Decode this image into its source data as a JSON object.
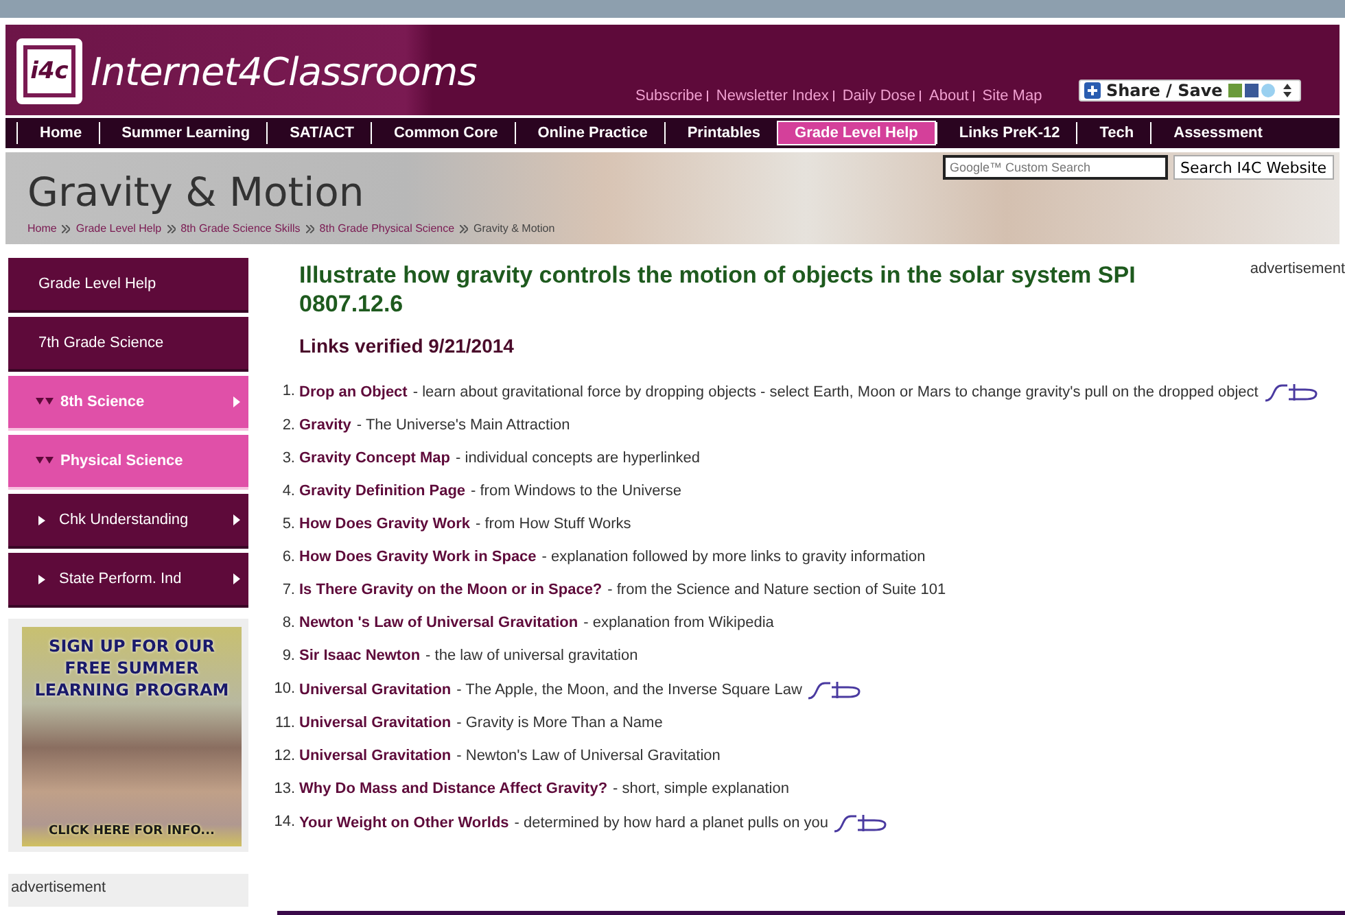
{
  "header": {
    "logo_mark": "i4c",
    "site_name": "Internet4Classrooms",
    "links": [
      "Subscribe",
      "Newsletter Index",
      "Daily Dose",
      "About",
      "Site Map"
    ],
    "share_button": "Share / Save"
  },
  "nav": [
    {
      "label": "Home",
      "selected": false
    },
    {
      "label": "Summer Learning",
      "selected": false
    },
    {
      "label": "SAT/ACT",
      "selected": false
    },
    {
      "label": "Common Core",
      "selected": false
    },
    {
      "label": "Online Practice",
      "selected": false
    },
    {
      "label": "Printables",
      "selected": false
    },
    {
      "label": "Grade Level Help",
      "selected": true
    },
    {
      "label": "Links PreK-12",
      "selected": false
    },
    {
      "label": "Tech",
      "selected": false
    },
    {
      "label": "Assessment",
      "selected": false
    }
  ],
  "banner": {
    "title": "Gravity & Motion",
    "search": {
      "placeholder": "Google™ Custom Search"
    },
    "search_button": "Search I4C Website",
    "breadcrumb": [
      "Home",
      "Grade Level Help",
      "8th Grade Science Skills",
      "8th Grade Physical Science",
      "Gravity & Motion"
    ]
  },
  "sidebar": {
    "items": [
      {
        "label": "Grade Level Help",
        "kind": "top",
        "selected": false,
        "has_submenu": false
      },
      {
        "label": "7th Grade Science",
        "kind": "top",
        "selected": false,
        "has_submenu": false
      },
      {
        "label": "8th Science",
        "kind": "section",
        "selected": true,
        "has_submenu": true
      },
      {
        "label": "Physical Science",
        "kind": "section",
        "selected": true,
        "has_submenu": false
      },
      {
        "label": "Chk Understanding",
        "kind": "sub",
        "selected": false,
        "has_submenu": true
      },
      {
        "label": "State Perform. Ind",
        "kind": "sub",
        "selected": false,
        "has_submenu": true
      }
    ],
    "promo": {
      "headline": "SIGN UP FOR OUR FREE SUMMER LEARNING PROGRAM",
      "cta": "CLICK HERE FOR INFO..."
    },
    "ad_label": "advertisement"
  },
  "content": {
    "heading": "Illustrate how gravity controls the motion of objects in the solar system SPI 0807.12.6",
    "verified": "Links verified 9/21/2014",
    "ad_label": "advertisement",
    "links": [
      {
        "number": "1.",
        "title": "Drop an Object",
        "description": "- learn about gravitational force by dropping objects - select Earth, Moon or Mars to change gravity's pull on the dropped object",
        "interactive": true
      },
      {
        "number": "2.",
        "title": "Gravity",
        "description": "- The Universe's Main Attraction",
        "interactive": false
      },
      {
        "number": "3.",
        "title": "Gravity Concept Map",
        "description": "- individual concepts are hyperlinked",
        "interactive": false
      },
      {
        "number": "4.",
        "title": "Gravity Definition Page",
        "description": "- from Windows to the Universe",
        "interactive": false
      },
      {
        "number": "5.",
        "title": "How Does Gravity Work",
        "description": "- from How Stuff Works",
        "interactive": false
      },
      {
        "number": "6.",
        "title": "How Does Gravity Work in Space",
        "description": "- explanation followed by more links to gravity information",
        "interactive": false
      },
      {
        "number": "7.",
        "title": "Is There Gravity on the Moon or in Space?",
        "description": "- from the Science and Nature section of Suite 101",
        "interactive": false
      },
      {
        "number": "8.",
        "title": "Newton 's Law of Universal Gravitation",
        "description": "- explanation from Wikipedia",
        "interactive": false
      },
      {
        "number": "9.",
        "title": "Sir Isaac Newton",
        "description": "- the law of universal gravitation",
        "interactive": false
      },
      {
        "number": "10.",
        "title": "Universal Gravitation",
        "description": "- The Apple, the Moon, and the Inverse Square Law",
        "interactive": true
      },
      {
        "number": "11.",
        "title": "Universal Gravitation",
        "description": "- Gravity is More Than a Name",
        "interactive": false
      },
      {
        "number": "12.",
        "title": "Universal Gravitation",
        "description": "- Newton's Law of Universal Gravitation",
        "interactive": false
      },
      {
        "number": "13.",
        "title": "Why Do Mass and Distance Affect Gravity?",
        "description": "- short, simple explanation",
        "interactive": false
      },
      {
        "number": "14.",
        "title": "Your Weight on Other Worlds",
        "description": "- determined by how hard a planet pulls on you",
        "interactive": true
      }
    ]
  }
}
